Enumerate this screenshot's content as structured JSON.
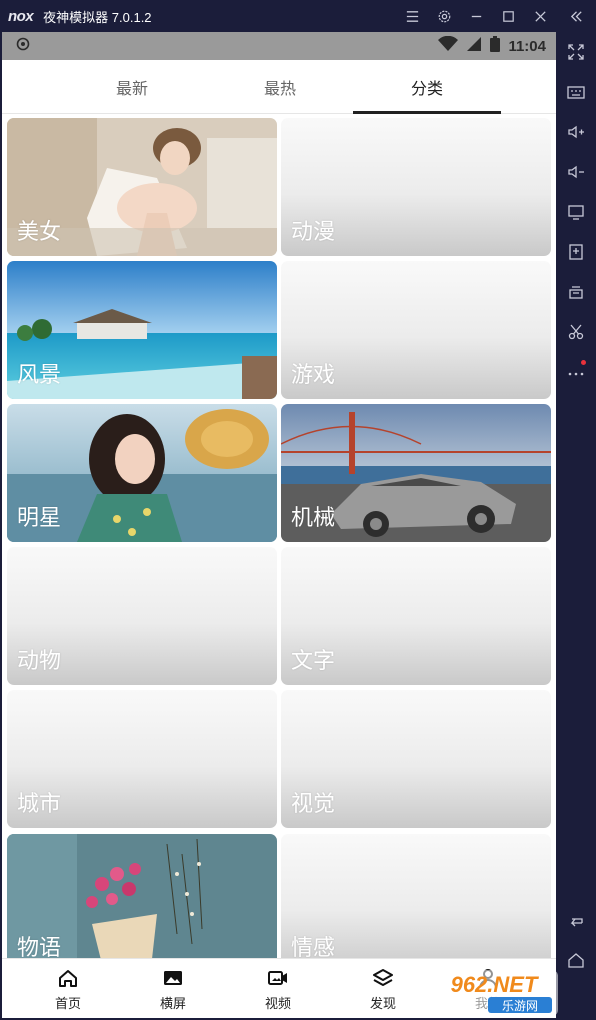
{
  "titlebar": {
    "logo": "nox",
    "title": "夜神模拟器 7.0.1.2"
  },
  "statusbar": {
    "time": "11:04"
  },
  "tabs": [
    {
      "label": "最新",
      "active": false
    },
    {
      "label": "最热",
      "active": false
    },
    {
      "label": "分类",
      "active": true
    }
  ],
  "categories": [
    {
      "label": "美女",
      "has_image": true
    },
    {
      "label": "动漫",
      "has_image": false
    },
    {
      "label": "风景",
      "has_image": true
    },
    {
      "label": "游戏",
      "has_image": false
    },
    {
      "label": "明星",
      "has_image": true
    },
    {
      "label": "机械",
      "has_image": true
    },
    {
      "label": "动物",
      "has_image": false
    },
    {
      "label": "文字",
      "has_image": false
    },
    {
      "label": "城市",
      "has_image": false
    },
    {
      "label": "视觉",
      "has_image": false
    },
    {
      "label": "物语",
      "has_image": true
    },
    {
      "label": "情感",
      "has_image": false
    }
  ],
  "bottomnav": [
    {
      "label": "首页",
      "icon": "home-icon"
    },
    {
      "label": "横屏",
      "icon": "image-icon"
    },
    {
      "label": "视频",
      "icon": "video-icon"
    },
    {
      "label": "发现",
      "icon": "layers-icon"
    },
    {
      "label": "我的",
      "icon": "user-icon"
    }
  ],
  "watermark": {
    "text": "962.NET",
    "subtext": "乐游网"
  },
  "colors": {
    "emulator_bg": "#1b1d3a",
    "statusbar_bg": "#9a9a9a",
    "accent": "#222222",
    "notification_dot": "#e8323c"
  }
}
